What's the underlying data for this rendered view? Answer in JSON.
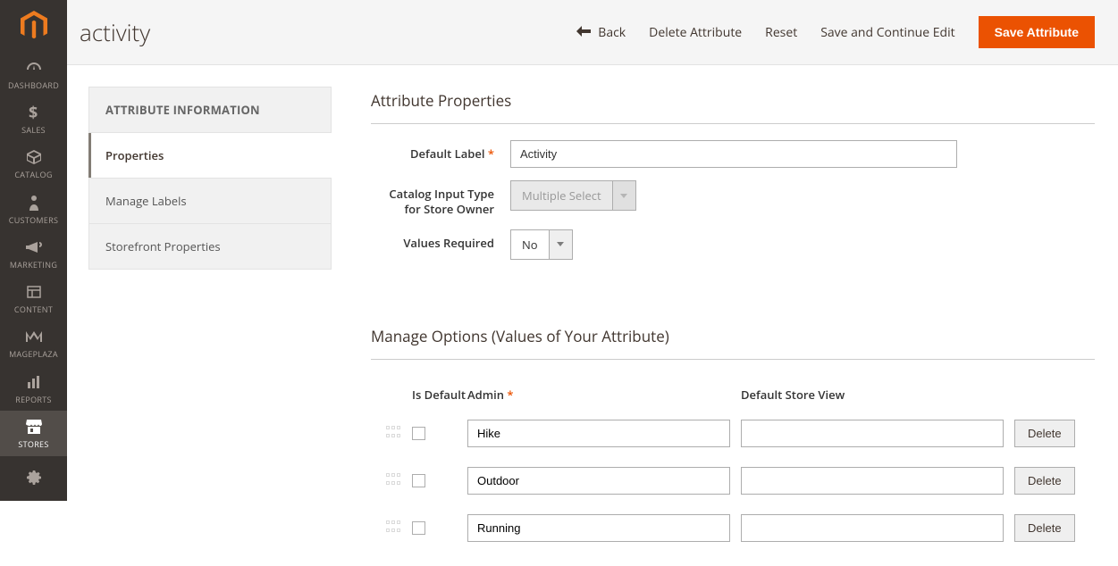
{
  "sidebar": {
    "items": [
      {
        "label": "DASHBOARD",
        "icon": "dashboard"
      },
      {
        "label": "SALES",
        "icon": "dollar"
      },
      {
        "label": "CATALOG",
        "icon": "box"
      },
      {
        "label": "CUSTOMERS",
        "icon": "person"
      },
      {
        "label": "MARKETING",
        "icon": "megaphone"
      },
      {
        "label": "CONTENT",
        "icon": "layout"
      },
      {
        "label": "MAGEPLAZA",
        "icon": "mp"
      },
      {
        "label": "REPORTS",
        "icon": "bars"
      },
      {
        "label": "STORES",
        "icon": "storefront",
        "active": true
      },
      {
        "label": "",
        "icon": "gear"
      }
    ]
  },
  "header": {
    "title": "activity",
    "back": "Back",
    "delete": "Delete Attribute",
    "reset": "Reset",
    "save_continue": "Save and Continue Edit",
    "save": "Save Attribute"
  },
  "tabs": {
    "title": "ATTRIBUTE INFORMATION",
    "items": [
      {
        "label": "Properties",
        "active": true
      },
      {
        "label": "Manage Labels"
      },
      {
        "label": "Storefront Properties"
      }
    ]
  },
  "props_section_title": "Attribute Properties",
  "fields": {
    "default_label": {
      "label": "Default Label",
      "value": "Activity"
    },
    "input_type": {
      "label": "Catalog Input Type for Store Owner",
      "value": "Multiple Select"
    },
    "values_required": {
      "label": "Values Required",
      "value": "No"
    }
  },
  "options_section_title": "Manage Options (Values of Your Attribute)",
  "options_header": {
    "is_default": "Is Default",
    "admin": "Admin",
    "store": "Default Store View"
  },
  "options_rows": [
    {
      "admin": "Hike",
      "store": ""
    },
    {
      "admin": "Outdoor",
      "store": ""
    },
    {
      "admin": "Running",
      "store": ""
    }
  ],
  "delete_label": "Delete"
}
